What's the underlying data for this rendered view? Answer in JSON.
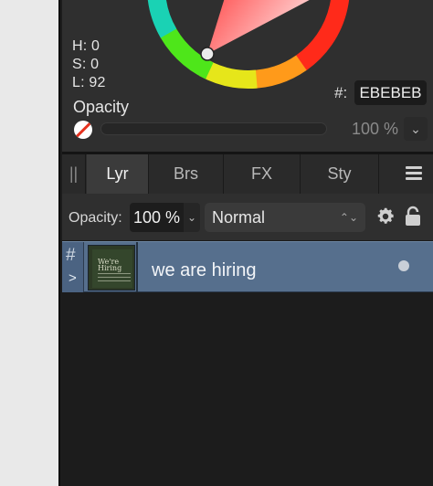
{
  "color_panel": {
    "h": "H: 0",
    "s": "S: 0",
    "l": "L: 92",
    "hex_label": "#:",
    "hex_value": "EBEBEB",
    "opacity_label": "Opacity",
    "opacity_value": "100 %",
    "opacity_fraction": 1.0,
    "current_color": "#EBEBEB"
  },
  "tabs": [
    {
      "label": "Lyr",
      "active": true
    },
    {
      "label": "Brs",
      "active": false
    },
    {
      "label": "FX",
      "active": false
    },
    {
      "label": "Sty",
      "active": false
    }
  ],
  "layers_toolbar": {
    "opacity_label": "Opacity:",
    "opacity_value": "100 %",
    "blend_mode": "Normal"
  },
  "layers": [
    {
      "name": "we are hiring",
      "thumbnail_text": "We're Hiring"
    }
  ],
  "icons": {
    "grip": "grip-icon",
    "menu": "hamburger-menu-icon",
    "gear": "gear-icon",
    "lock": "lock-icon",
    "hash": "hash-icon",
    "expand": "chevron-right-icon",
    "visibility": "visibility-dot-icon",
    "none_swatch": "no-color-swatch-icon"
  },
  "colors": {
    "selected_row": "#566F8D",
    "panel_bg": "#2F2F2F"
  }
}
